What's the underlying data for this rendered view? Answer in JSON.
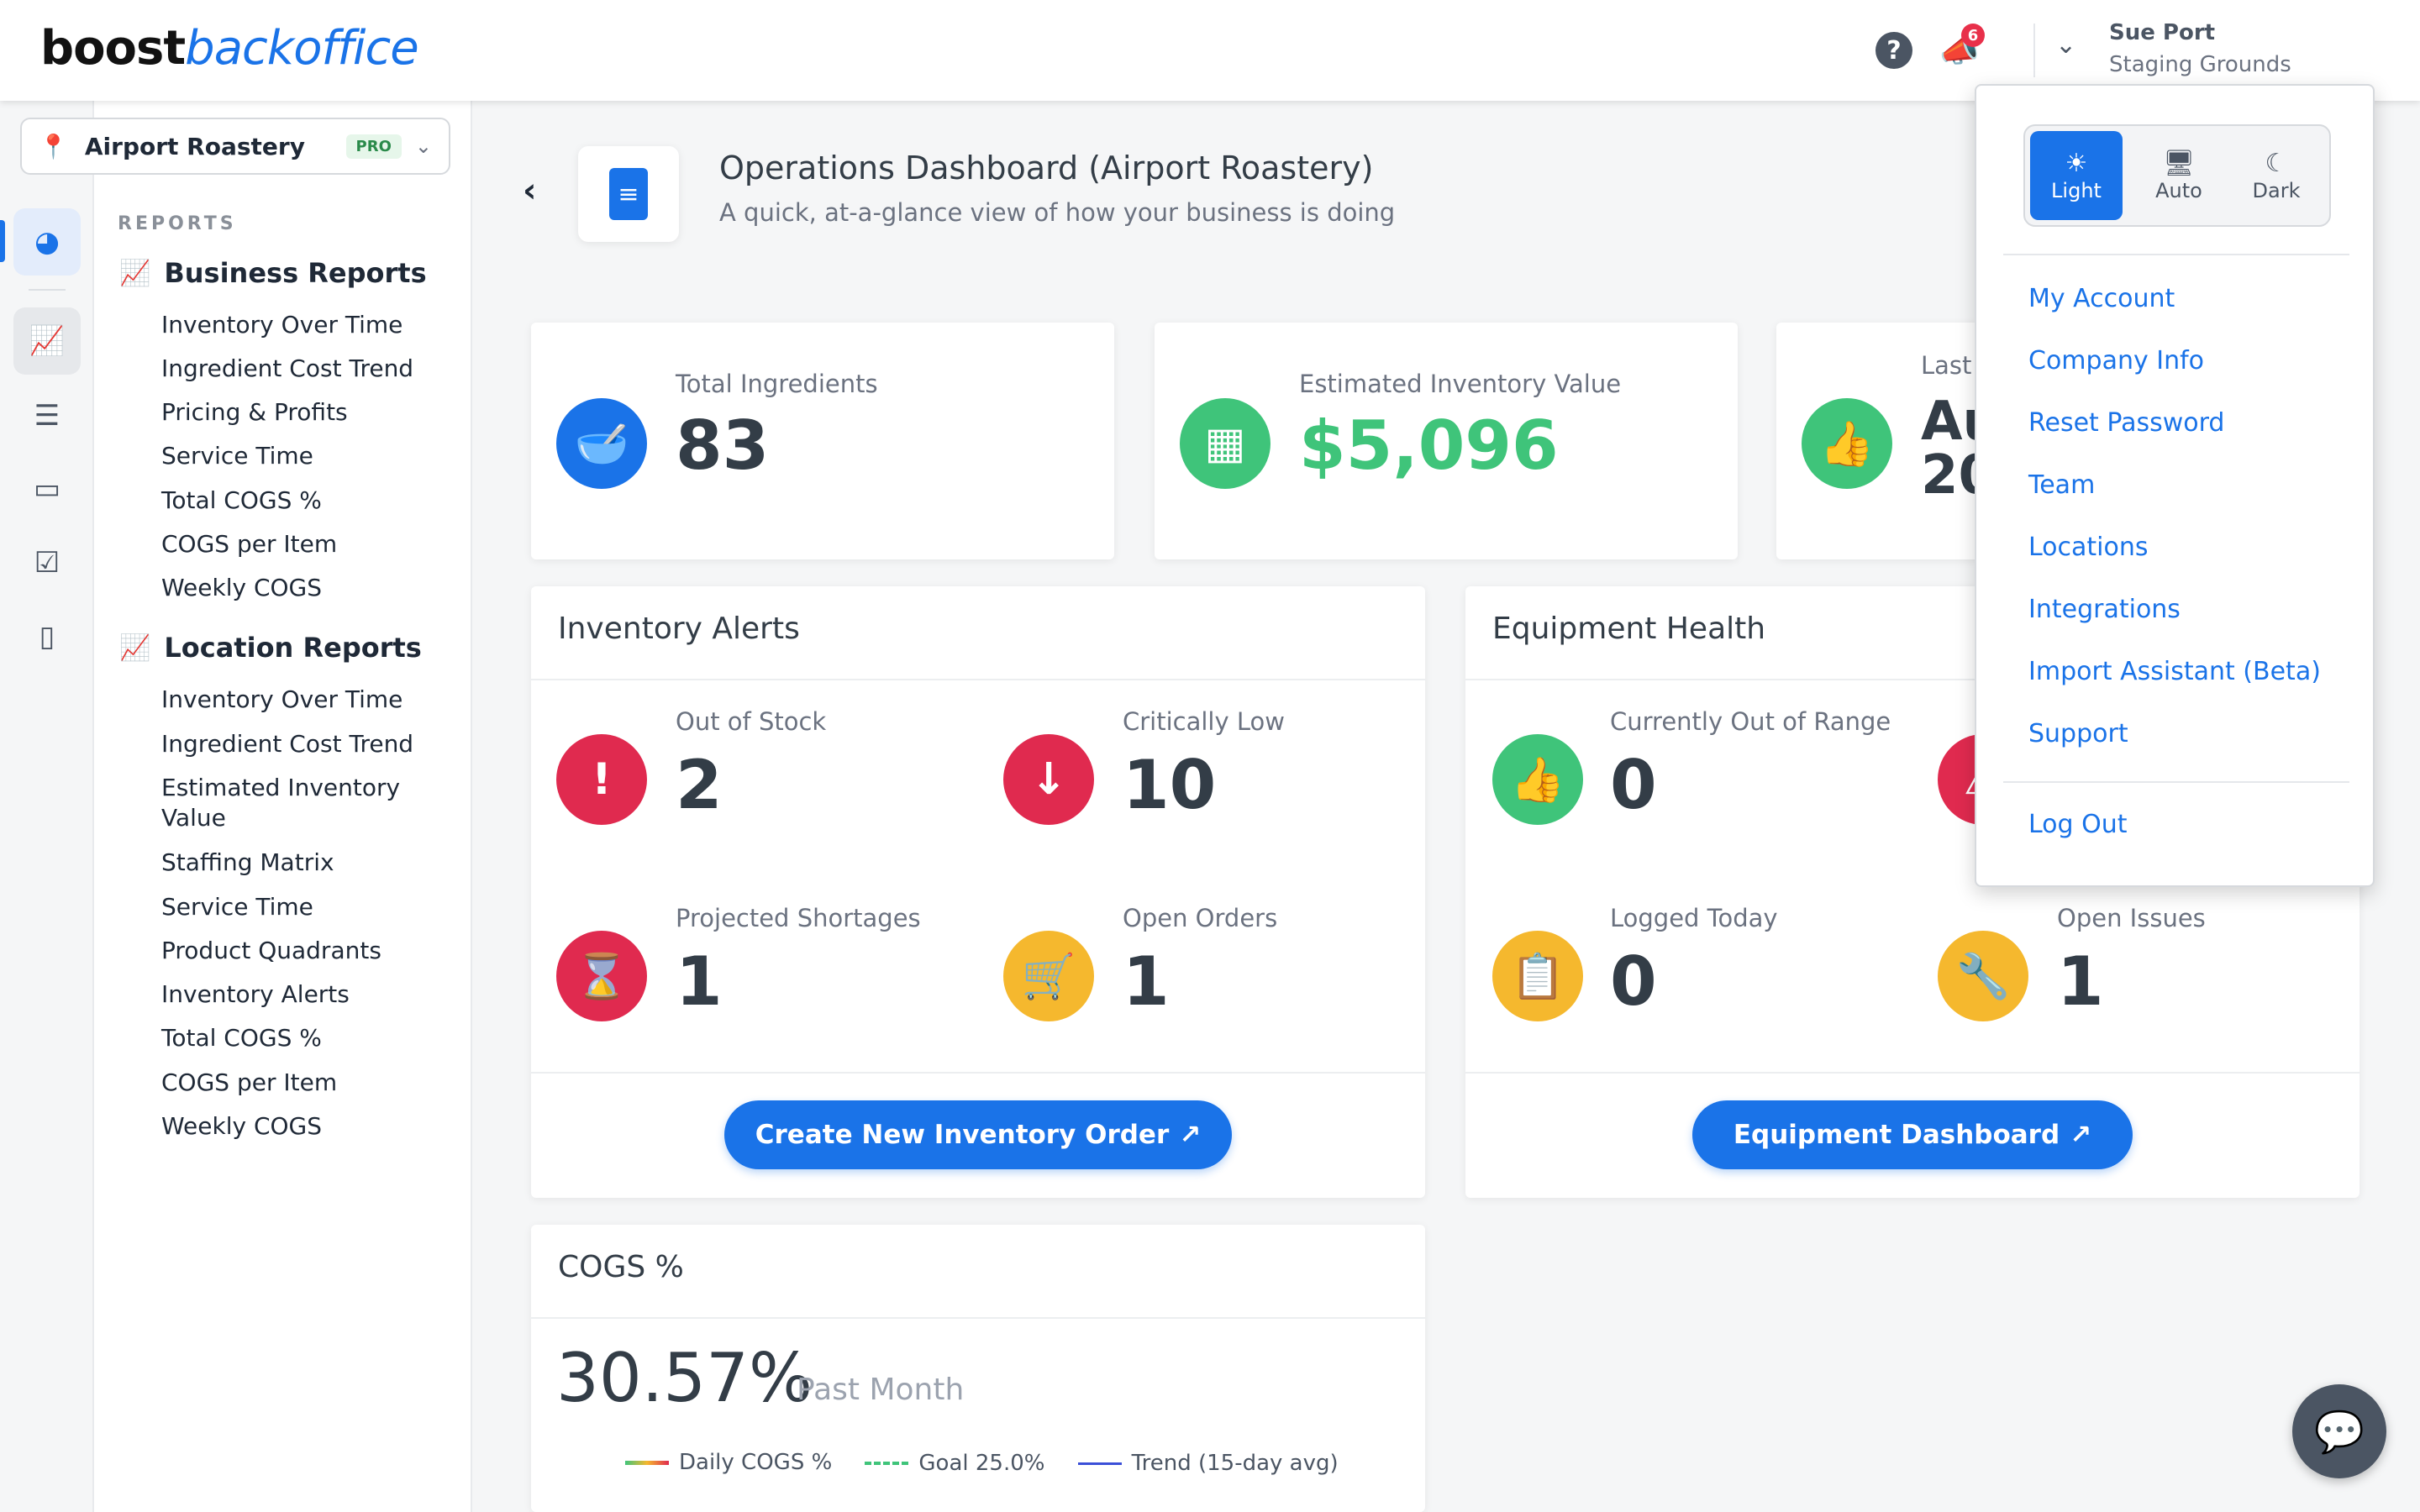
{
  "brand": {
    "part1": "boost",
    "part2": "backoffice"
  },
  "header": {
    "notifications_count": "6",
    "user_name": "Sue Port",
    "user_org": "Staging Grounds"
  },
  "location": {
    "name": "Airport Roastery",
    "badge": "PRO"
  },
  "sidebar": {
    "reports_heading": "REPORTS",
    "business_heading": "Business Reports",
    "business_items": [
      "Inventory Over Time",
      "Ingredient Cost Trend",
      "Pricing & Profits",
      "Service Time",
      "Total COGS %",
      "COGS per Item",
      "Weekly COGS"
    ],
    "location_heading": "Location Reports",
    "location_items": [
      "Inventory Over Time",
      "Ingredient Cost Trend",
      "Estimated Inventory",
      "Value",
      "Staffing Matrix",
      "Service Time",
      "Product Quadrants",
      "Inventory Alerts",
      "Total COGS %",
      "COGS per Item",
      "Weekly COGS"
    ]
  },
  "page": {
    "title": "Operations Dashboard (Airport Roastery)",
    "subtitle": "A quick, at-a-glance view of how your business is doing"
  },
  "kpis": [
    {
      "label": "Total Ingredients",
      "value": "83"
    },
    {
      "label": "Estimated Inventory Value",
      "value": "$5,096"
    },
    {
      "label": "Last",
      "value_line1": "Au",
      "value_line2": "20"
    }
  ],
  "inventory_alerts": {
    "title": "Inventory Alerts",
    "stats": [
      {
        "label": "Out of Stock",
        "value": "2"
      },
      {
        "label": "Critically Low",
        "value": "10"
      },
      {
        "label": "Projected Shortages",
        "value": "1"
      },
      {
        "label": "Open Orders",
        "value": "1"
      }
    ],
    "button": "Create New Inventory Order"
  },
  "equipment_health": {
    "title": "Equipment Health",
    "stats": [
      {
        "label": "Currently Out of Range",
        "value": "0"
      },
      {
        "label": "Logged Today",
        "value": "0"
      },
      {
        "label": "Open Issues",
        "value": "1"
      }
    ],
    "button": "Equipment Dashboard"
  },
  "cogs": {
    "title": "COGS %",
    "value": "30.57%",
    "period": "Past Month",
    "legend": [
      "Daily COGS %",
      "Goal 25.0%",
      "Trend (15-day avg)"
    ]
  },
  "menu": {
    "themes": [
      "Light",
      "Auto",
      "Dark"
    ],
    "items": [
      "My Account",
      "Company Info",
      "Reset Password",
      "Team",
      "Locations",
      "Integrations",
      "Import Assistant (Beta)",
      "Support"
    ],
    "logout": "Log Out"
  },
  "colors": {
    "accent": "#1a73e8",
    "red": "#e02a4f",
    "green": "#3fc47a",
    "yellow": "#f5b82e"
  }
}
